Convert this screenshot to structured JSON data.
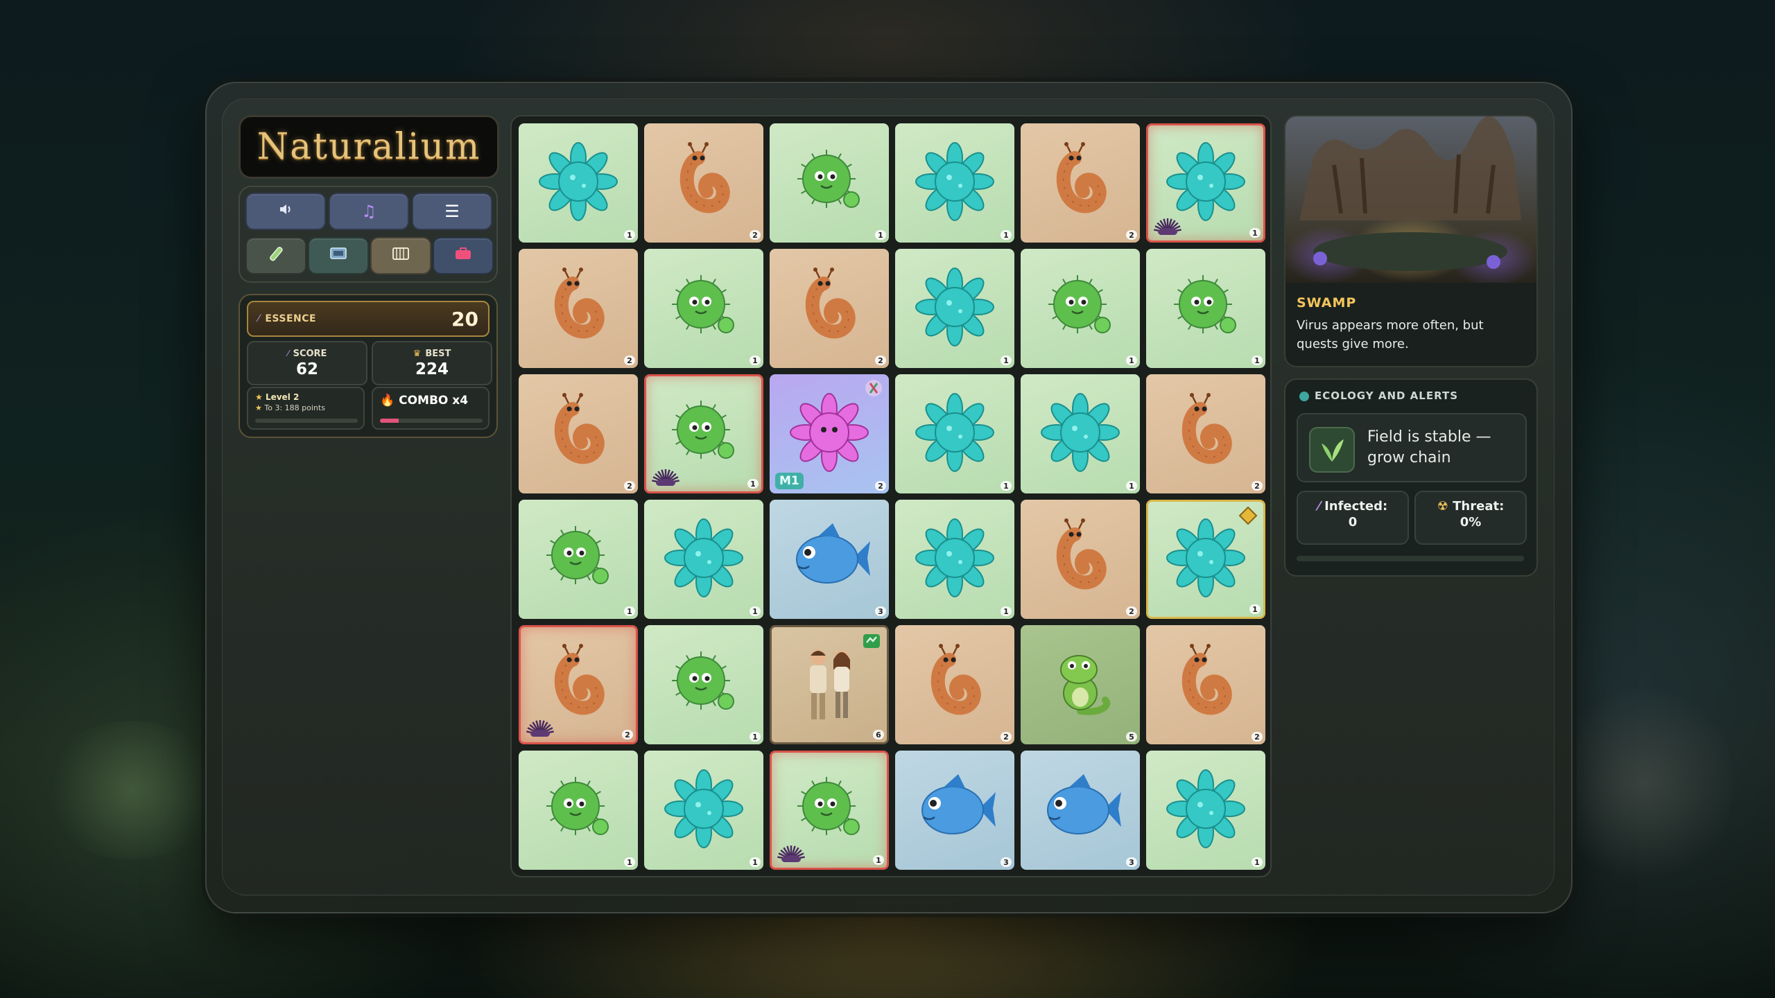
{
  "app": {
    "title": "Naturalium"
  },
  "controls": {
    "row1": [
      {
        "icon": "speaker-icon",
        "glyph": "🔊",
        "color": "#4c5a78"
      },
      {
        "icon": "music-note-icon",
        "glyph": "♫",
        "color": "#4c5a78"
      },
      {
        "icon": "menu-icon",
        "glyph": "☰",
        "color": "#4c5a78"
      }
    ],
    "row2": [
      {
        "icon": "test-tube-icon",
        "color": "#49534a"
      },
      {
        "icon": "microscope-icon",
        "color": "#3f5a54"
      },
      {
        "icon": "cage-icon",
        "color": "#6f6650"
      },
      {
        "icon": "toolbox-icon",
        "color": "#40506a"
      }
    ]
  },
  "stats": {
    "essence_label": "ESSENCE",
    "essence_value": "20",
    "score_label": "SCORE",
    "score_value": "62",
    "best_label": "BEST",
    "best_value": "224",
    "level_label": "Level 2",
    "level_next": "To 3: 188 points",
    "level_progress": 0,
    "combo_label": "COMBO x4",
    "combo_progress": 0.18
  },
  "board": {
    "rows": [
      [
        {
          "type": "virus",
          "level": "1"
        },
        {
          "type": "worm",
          "level": "2"
        },
        {
          "type": "bacterium",
          "level": "1"
        },
        {
          "type": "virus",
          "level": "1"
        },
        {
          "type": "worm",
          "level": "2"
        },
        {
          "type": "virus",
          "level": "1",
          "infected": true
        }
      ],
      [
        {
          "type": "worm",
          "level": "2"
        },
        {
          "type": "bacterium",
          "level": "1"
        },
        {
          "type": "worm",
          "level": "2"
        },
        {
          "type": "virus",
          "level": "1"
        },
        {
          "type": "bacterium",
          "level": "1"
        },
        {
          "type": "bacterium",
          "level": "1"
        }
      ],
      [
        {
          "type": "worm",
          "level": "2"
        },
        {
          "type": "bacterium",
          "level": "1",
          "infected": true
        },
        {
          "type": "mutant",
          "level": "2",
          "badge": "M1"
        },
        {
          "type": "virus",
          "level": "1"
        },
        {
          "type": "virus",
          "level": "1"
        },
        {
          "type": "worm",
          "level": "2"
        }
      ],
      [
        {
          "type": "bacterium",
          "level": "1"
        },
        {
          "type": "virus",
          "level": "1"
        },
        {
          "type": "fish",
          "level": "3"
        },
        {
          "type": "virus",
          "level": "1"
        },
        {
          "type": "worm",
          "level": "2"
        },
        {
          "type": "virus",
          "level": "1",
          "gold": true
        }
      ],
      [
        {
          "type": "worm",
          "level": "2",
          "infected": true
        },
        {
          "type": "bacterium",
          "level": "1"
        },
        {
          "type": "humans",
          "level": "6"
        },
        {
          "type": "worm",
          "level": "2"
        },
        {
          "type": "lizard",
          "level": "5"
        },
        {
          "type": "worm",
          "level": "2"
        }
      ],
      [
        {
          "type": "bacterium",
          "level": "1"
        },
        {
          "type": "virus",
          "level": "1"
        },
        {
          "type": "bacterium",
          "level": "1",
          "infected": true
        },
        {
          "type": "fish",
          "level": "3"
        },
        {
          "type": "fish",
          "level": "3"
        },
        {
          "type": "virus",
          "level": "1"
        }
      ]
    ]
  },
  "biome": {
    "title": "SWAMP",
    "description": "Virus appears more often, but quests give more."
  },
  "ecology": {
    "title": "ECOLOGY AND ALERTS",
    "status": "Field is stable — grow chain",
    "infected_label": "Infected:",
    "infected_value": "0",
    "threat_label": "Threat:",
    "threat_value": "0%"
  },
  "colors": {
    "accent_gold": "#f3c55c",
    "infection_red": "#d9534a",
    "combo_pink": "#e2537a"
  }
}
